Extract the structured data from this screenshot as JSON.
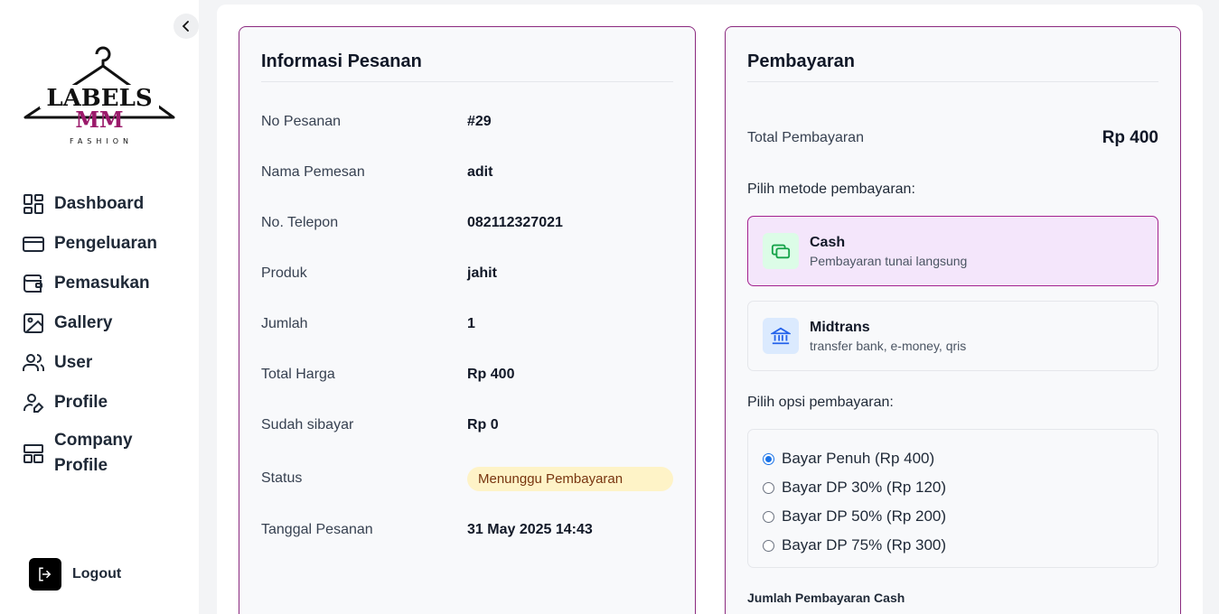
{
  "brand": {
    "line1": "LABELS",
    "line2": "MM",
    "tagline": "FASHION"
  },
  "sidebar": {
    "items": [
      {
        "label": "Dashboard",
        "icon": "dashboard-icon"
      },
      {
        "label": "Pengeluaran",
        "icon": "credit-card-icon"
      },
      {
        "label": "Pemasukan",
        "icon": "wallet-icon"
      },
      {
        "label": "Gallery",
        "icon": "image-icon"
      },
      {
        "label": "User",
        "icon": "users-icon"
      },
      {
        "label": "Profile",
        "icon": "user-edit-icon"
      },
      {
        "label": "Company Profile",
        "icon": "layout-icon"
      }
    ],
    "logout": "Logout"
  },
  "order_info": {
    "title": "Informasi Pesanan",
    "rows": [
      {
        "label": "No Pesanan",
        "value": "#29"
      },
      {
        "label": "Nama Pemesan",
        "value": "adit"
      },
      {
        "label": "No. Telepon",
        "value": "082112327021"
      },
      {
        "label": "Produk",
        "value": "jahit"
      },
      {
        "label": "Jumlah",
        "value": "1"
      },
      {
        "label": "Total Harga",
        "value": "Rp 400"
      },
      {
        "label": "Sudah sibayar",
        "value": "Rp 0"
      },
      {
        "label": "Status",
        "value": "Menunggu Pembayaran"
      },
      {
        "label": "Tanggal Pesanan",
        "value": "31 May 2025 14:43"
      }
    ]
  },
  "payment": {
    "title": "Pembayaran",
    "total_label": "Total Pembayaran",
    "total_value": "Rp 400",
    "method_prompt": "Pilih metode pembayaran:",
    "methods": [
      {
        "title": "Cash",
        "subtitle": "Pembayaran tunai langsung",
        "selected": true
      },
      {
        "title": "Midtrans",
        "subtitle": "transfer bank, e-money, qris",
        "selected": false
      }
    ],
    "option_prompt": "Pilih opsi pembayaran:",
    "options": [
      {
        "label": "Bayar Penuh (Rp 400)",
        "checked": true
      },
      {
        "label": "Bayar DP 30% (Rp 120)",
        "checked": false
      },
      {
        "label": "Bayar DP 50% (Rp 200)",
        "checked": false
      },
      {
        "label": "Bayar DP 75% (Rp 300)",
        "checked": false
      }
    ],
    "cash_amount_label": "Jumlah Pembayaran Cash"
  },
  "colors": {
    "accent": "#8b2a7f",
    "brand_magenta": "#9b1a6b",
    "status_bg": "#fef3c7"
  }
}
